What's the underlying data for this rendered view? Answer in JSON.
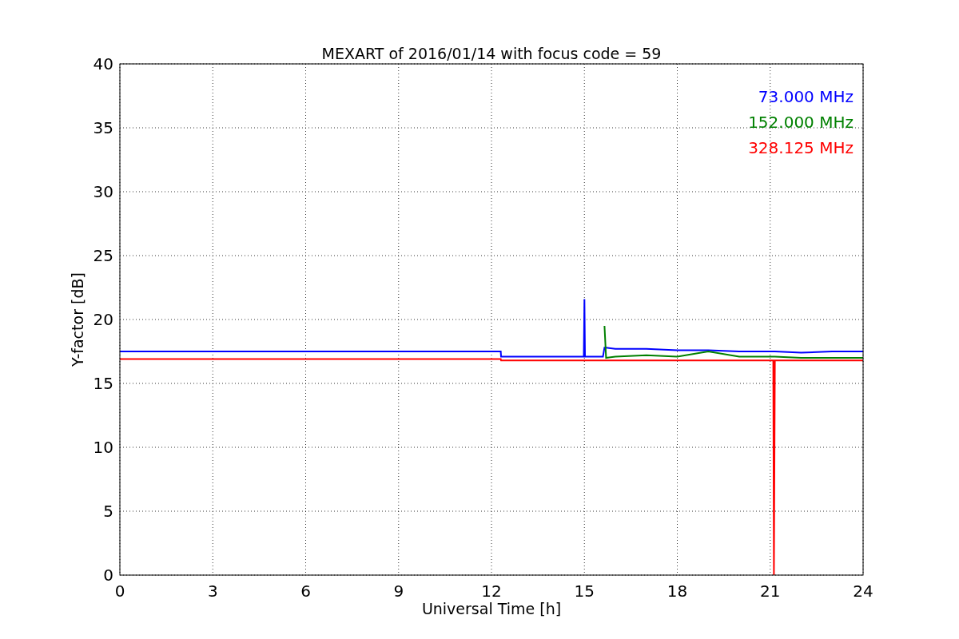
{
  "chart_data": {
    "type": "line",
    "title": "MEXART of 2016/01/14 with focus code = 59",
    "xlabel": "Universal Time [h]",
    "ylabel": "Y-factor [dB]",
    "x": [
      0,
      0.25,
      0.26,
      12.3,
      12.31,
      14,
      14.98,
      15,
      15.02,
      15.6,
      15.65,
      15.7,
      16,
      17,
      18,
      19,
      20,
      21,
      21.1,
      21.12,
      21.15,
      22,
      23,
      24
    ],
    "series": [
      {
        "name": "73.000 MHz",
        "color": "#0000ff",
        "values": [
          17.5,
          17.5,
          17.5,
          17.5,
          17.1,
          17.1,
          17.1,
          21.6,
          17.1,
          17.1,
          17.8,
          17.8,
          17.7,
          17.7,
          17.6,
          17.6,
          17.5,
          17.5,
          17.5,
          17.5,
          17.5,
          17.4,
          17.5,
          17.5
        ]
      },
      {
        "name": "152.000 MHz",
        "color": "#008000",
        "values": [
          null,
          null,
          null,
          null,
          null,
          null,
          null,
          null,
          null,
          null,
          19.5,
          17.0,
          17.1,
          17.2,
          17.1,
          17.5,
          17.1,
          17.1,
          17.1,
          17.1,
          17.1,
          17.0,
          17.0,
          17.0
        ]
      },
      {
        "name": "328.125 MHz",
        "color": "#ff0000",
        "values": [
          16.9,
          16.9,
          16.9,
          16.9,
          16.8,
          16.8,
          16.8,
          16.8,
          16.8,
          16.8,
          16.8,
          16.8,
          16.8,
          16.8,
          16.8,
          16.8,
          16.8,
          16.8,
          16.8,
          0,
          16.8,
          16.8,
          16.8,
          16.8
        ]
      }
    ],
    "xlim": [
      0,
      24
    ],
    "ylim": [
      0,
      40
    ],
    "xticks": [
      0,
      3,
      6,
      9,
      12,
      15,
      18,
      21,
      24
    ],
    "yticks": [
      0,
      5,
      10,
      15,
      20,
      25,
      30,
      35,
      40
    ],
    "grid": true
  }
}
